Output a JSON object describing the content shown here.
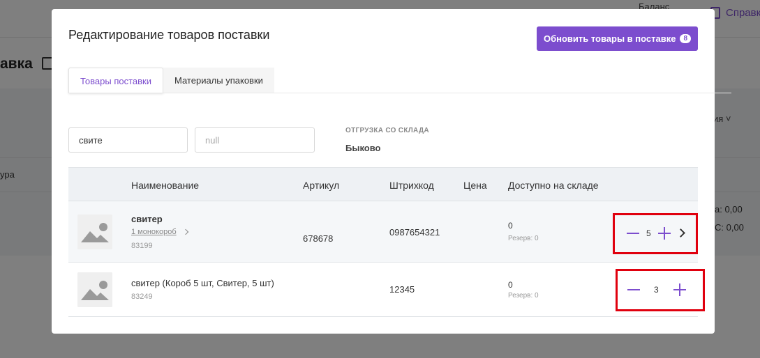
{
  "background": {
    "balance_label": "Баланс",
    "help_label": "Справка",
    "page_title": "авка",
    "dropdown_label": "ия",
    "column_header": "ура",
    "summary_line1": "а: 0,00",
    "summary_line2": "С: 0,00"
  },
  "modal": {
    "title": "Редактирование товаров поставки",
    "update_button": {
      "label": "Обновить товары в поставке",
      "badge": "8"
    },
    "tabs": [
      {
        "label": "Товары поставки",
        "active": true
      },
      {
        "label": "Материалы упаковки",
        "active": false
      }
    ],
    "filters": {
      "search_value": "свите",
      "second_value": "null"
    },
    "shipment": {
      "label": "ОТГРУЗКА СО СКЛАДА",
      "value": "Быково"
    },
    "table": {
      "headers": [
        "Наименование",
        "Артикул",
        "Штрихкод",
        "Цена",
        "Доступно на складе"
      ],
      "rows": [
        {
          "name": "свитер",
          "box_link": "1 монокороб",
          "id": "83199",
          "article": "678678",
          "barcode": "0987654321",
          "price": "",
          "available": "0",
          "reserve": "Резерв: 0",
          "quantity": "5"
        },
        {
          "name": "свитер (Короб 5 шт, Свитер, 5 шт)",
          "id": "83249",
          "article": "",
          "barcode": "12345",
          "price": "",
          "available": "0",
          "reserve": "Резерв: 0",
          "quantity": "3"
        }
      ]
    }
  },
  "colors": {
    "accent": "#7c4dce",
    "highlight": "#e0000e"
  }
}
